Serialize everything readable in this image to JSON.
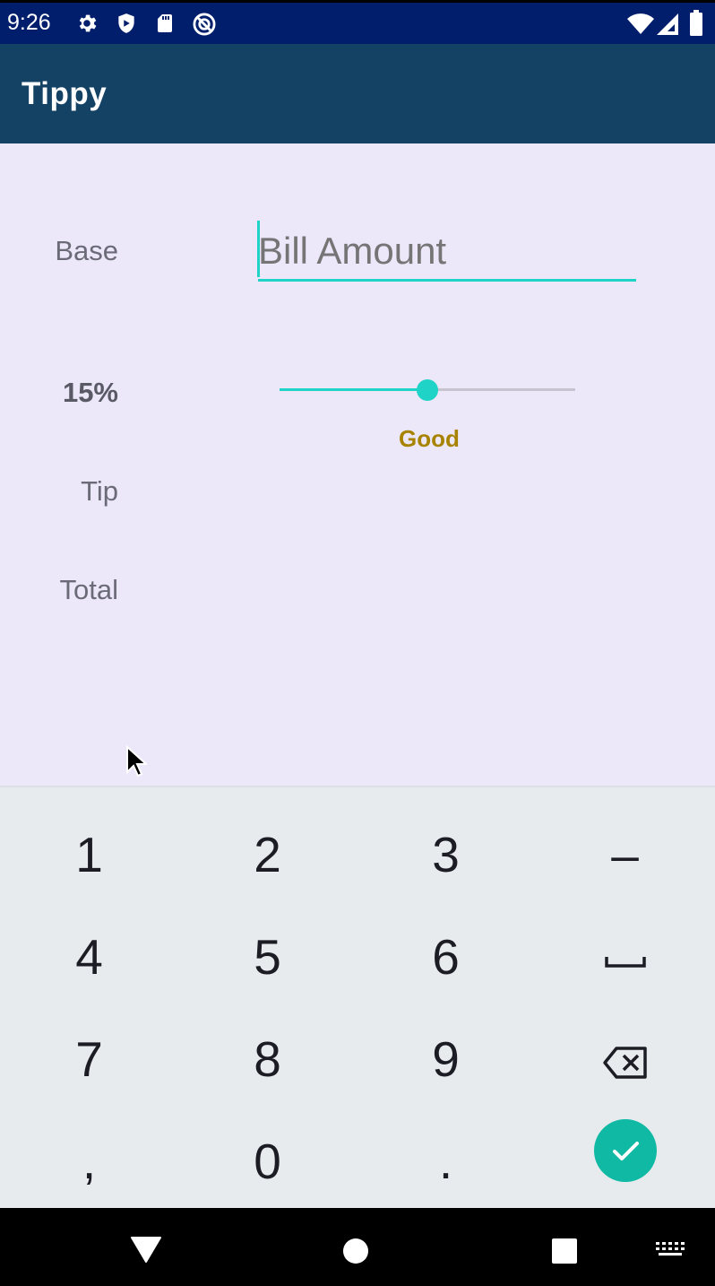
{
  "status_bar": {
    "time": "9:26",
    "icons_left": [
      "gear-icon",
      "shield-icon",
      "sd-card-icon",
      "no-disturb-icon"
    ],
    "icons_right": [
      "wifi-icon",
      "signal-icon",
      "battery-icon"
    ]
  },
  "app_bar": {
    "title": "Tippy"
  },
  "form": {
    "base_label": "Base",
    "bill_placeholder": "Bill Amount",
    "percent_label": "15%",
    "tip_label": "Tip",
    "total_label": "Total",
    "slider_fraction": 0.5,
    "tip_description": "Good"
  },
  "keyboard": {
    "keys": [
      "1",
      "2",
      "3",
      "–",
      "4",
      "5",
      "6",
      "␣",
      "7",
      "8",
      "9",
      "⌫",
      ",",
      "0",
      ".",
      "✓"
    ]
  },
  "colors": {
    "accent": "#1fd3c6",
    "app_bar": "#134265",
    "status_bar": "#001e6b",
    "good_text": "#a88300",
    "enter_key": "#0fb9a4"
  }
}
